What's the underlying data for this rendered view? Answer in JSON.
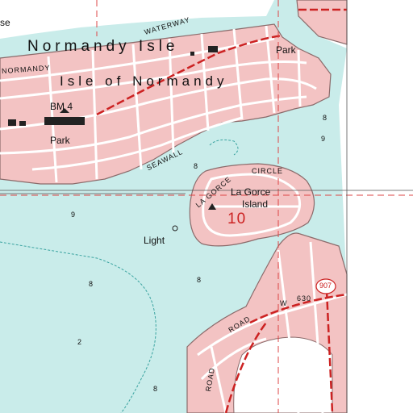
{
  "map": {
    "labels": {
      "normandy_isle": "Normandy Isle",
      "isle_of_normandy": "Isle of Normandy",
      "waterway": "WATERWAY",
      "normandy_shores": "NORMANDY",
      "park_east": "Park",
      "park_west": "Park",
      "bm": "BM 4",
      "seawall": "SEAWALL",
      "circle": "CIRCLE",
      "la_gorce": "La Gorce",
      "island": "Island",
      "la_gorce_road": "LA GORCE",
      "section": "10",
      "light": "Light",
      "highway_shield": "907",
      "road_number": "630",
      "road": "ROAD",
      "road_w": "W",
      "road_lower": "ROAD",
      "partial_left": "se"
    },
    "depths": [
      "8",
      "9",
      "8",
      "9",
      "8",
      "2",
      "8",
      "8"
    ],
    "colors": {
      "water": "#c9ecea",
      "land": "#ffffff",
      "urban": "#f3c3c3",
      "street": "#ffffff",
      "road_outline": "#8a6a6a",
      "highway": "#cc2222",
      "section_line": "#dd4444",
      "grid": "#555555"
    }
  }
}
